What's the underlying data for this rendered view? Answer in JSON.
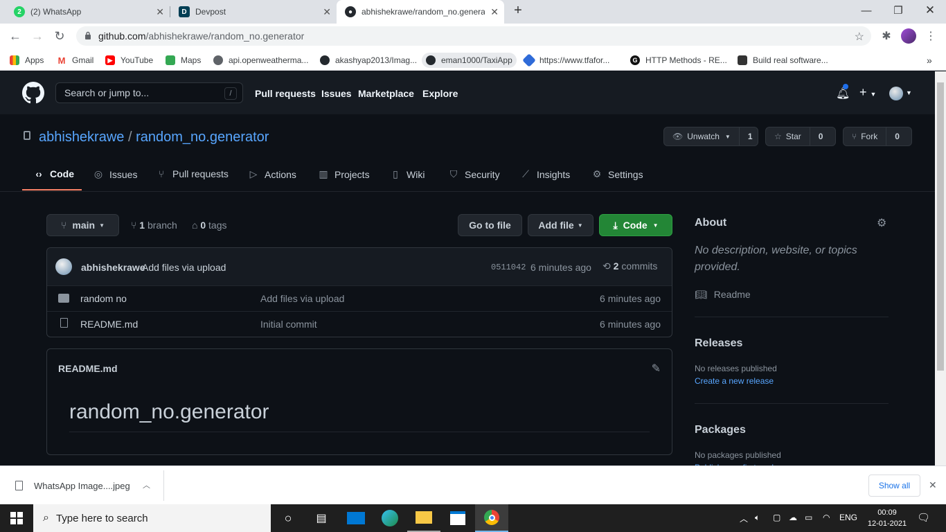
{
  "browser": {
    "tabs": [
      {
        "label": "(2) WhatsApp",
        "icon": "whatsapp-icon",
        "badge": "2"
      },
      {
        "label": "Devpost",
        "icon": "devpost-icon",
        "badge": "D"
      },
      {
        "label": "abhishekrawe/random_no.generator",
        "icon": "github-icon"
      }
    ],
    "url_host": "github.com",
    "url_path": "/abhishekrawe/random_no.generator",
    "bookmarks": [
      {
        "label": "Apps",
        "icon": "apps-grid-icon"
      },
      {
        "label": "Gmail",
        "icon": "gmail-icon"
      },
      {
        "label": "YouTube",
        "icon": "youtube-icon"
      },
      {
        "label": "Maps",
        "icon": "maps-icon"
      },
      {
        "label": "api.openweatherma...",
        "icon": "globe-icon"
      },
      {
        "label": "akashyap2013/Imag...",
        "icon": "github-icon"
      },
      {
        "label": "eman1000/TaxiApp",
        "icon": "github-icon"
      },
      {
        "label": "https://www.tfafor...",
        "icon": "tfa-icon"
      },
      {
        "label": "HTTP Methods - RE...",
        "icon": "g-icon"
      },
      {
        "label": "Build real software...",
        "icon": "build-icon"
      }
    ],
    "more": "»"
  },
  "github": {
    "search_placeholder": "Search or jump to...",
    "search_key": "/",
    "nav": [
      "Pull requests",
      "Issues",
      "Marketplace",
      "Explore"
    ],
    "owner": "abhishekrawe",
    "separator": "/",
    "repo": "random_no.generator",
    "unwatch_label": "Unwatch",
    "watch_count": "1",
    "star_label": "Star",
    "star_count": "0",
    "fork_label": "Fork",
    "fork_count": "0",
    "tabs": [
      {
        "label": "Code",
        "icon": "code-icon"
      },
      {
        "label": "Issues",
        "icon": "issue-icon"
      },
      {
        "label": "Pull requests",
        "icon": "pull-request-icon"
      },
      {
        "label": "Actions",
        "icon": "play-icon"
      },
      {
        "label": "Projects",
        "icon": "project-icon"
      },
      {
        "label": "Wiki",
        "icon": "book-icon"
      },
      {
        "label": "Security",
        "icon": "shield-icon"
      },
      {
        "label": "Insights",
        "icon": "graph-icon"
      },
      {
        "label": "Settings",
        "icon": "gear-icon"
      }
    ]
  },
  "repo": {
    "branch": "main",
    "branch_count": "1",
    "branch_word": "branch",
    "tag_count": "0",
    "tag_word": "tags",
    "go_to_file": "Go to file",
    "add_file": "Add file",
    "code_button": "Code",
    "commit_author": "abhishekrawe",
    "commit_message": "Add files via upload",
    "commit_sha": "0511042",
    "commit_time": "6 minutes ago",
    "commit_count": "2",
    "commit_word": "commits",
    "files": [
      {
        "name": "random no",
        "type": "folder",
        "message": "Add files via upload",
        "time": "6 minutes ago"
      },
      {
        "name": "README.md",
        "type": "file",
        "message": "Initial commit",
        "time": "6 minutes ago"
      }
    ],
    "readme_filename": "README.md",
    "readme_heading": "random_no.generator"
  },
  "sidebar": {
    "about_title": "About",
    "about_text": "No description, website, or topics provided.",
    "readme_link": "Readme",
    "releases_title": "Releases",
    "releases_text": "No releases published",
    "releases_link": "Create a new release",
    "packages_title": "Packages",
    "packages_text": "No packages published",
    "packages_link": "Publish your first package"
  },
  "download_bar": {
    "filename": "WhatsApp Image....jpeg",
    "show_all": "Show all"
  },
  "taskbar": {
    "search_placeholder": "Type here to search",
    "language": "ENG",
    "time": "00:09",
    "date": "12-01-2021"
  },
  "colors": {
    "accent_green": "#238636",
    "link_blue": "#58a6ff",
    "tab_underline": "#f78166"
  }
}
